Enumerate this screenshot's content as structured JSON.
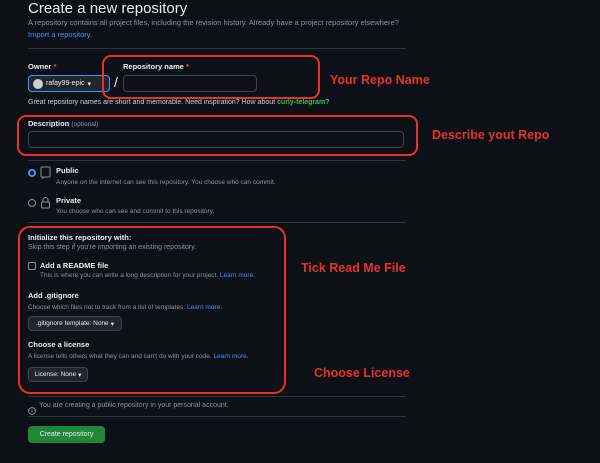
{
  "header": {
    "title": "Create a new repository",
    "description": "A repository contains all project files, including the revision history. Already have a project repository elsewhere?",
    "import_link": "Import a repository."
  },
  "owner": {
    "label": "Owner",
    "required_mark": "*",
    "value": "rafay99-epic",
    "caret": "▾"
  },
  "repo_name": {
    "label": "Repository name",
    "required_mark": "*",
    "separator": "/",
    "value": ""
  },
  "name_hint": {
    "text": "Great repository names are short and memorable. Need inspiration? How about",
    "suggestion": "curly-telegram",
    "suffix": "?"
  },
  "description": {
    "label": "Description",
    "optional": "(optional)",
    "value": ""
  },
  "visibility": {
    "public": {
      "label": "Public",
      "desc": "Anyone on the internet can see this repository. You choose who can commit.",
      "selected": true
    },
    "private": {
      "label": "Private",
      "desc": "You choose who can see and commit to this repository.",
      "selected": false
    }
  },
  "init": {
    "heading": "Initialize this repository with:",
    "skip_note": "Skip this step if you're importing an existing repository.",
    "readme_label": "Add a README file",
    "readme_desc": "This is where you can write a long description for your project.",
    "learn_more": "Learn more.",
    "gitignore_heading": "Add .gitignore",
    "gitignore_desc": "Choose which files not to track from a list of templates.",
    "gitignore_select": ".gitignore template: None",
    "license_heading": "Choose a license",
    "license_desc": "A license tells others what they can and can't do with your code.",
    "license_select": "License: None"
  },
  "notice": {
    "icon": "info-icon",
    "text": "You are creating a public repository in your personal account."
  },
  "create_button": "Create repository",
  "annotations": {
    "repo_name": "Your Repo Name",
    "description": "Describe yout Repo",
    "readme": "Tick Read Me File",
    "license": "Choose License",
    "color": "#e5322d"
  }
}
